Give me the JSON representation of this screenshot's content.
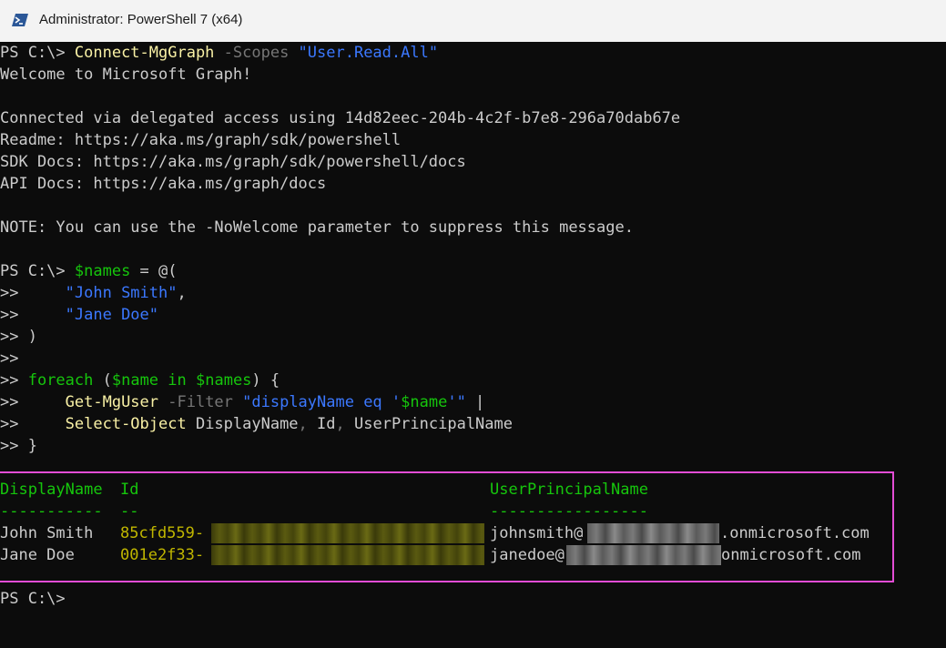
{
  "window": {
    "title": "Administrator: PowerShell 7 (x64)"
  },
  "console": {
    "l1": {
      "prompt": "PS C:\\> ",
      "cmd": "Connect-MgGraph",
      "param": " -Scopes",
      "str": " \"User.Read.All\""
    },
    "l2": "Welcome to Microsoft Graph!",
    "l3": "Connected via delegated access using 14d82eec-204b-4c2f-b7e8-296a70dab67e",
    "l4": "Readme: https://aka.ms/graph/sdk/powershell",
    "l5": "SDK Docs: https://aka.ms/graph/sdk/powershell/docs",
    "l6": "API Docs: https://aka.ms/graph/docs",
    "l7": "NOTE: You can use the -NoWelcome parameter to suppress this message.",
    "l8": {
      "prompt": "PS C:\\> ",
      "var": "$names",
      "rest": " = @("
    },
    "l9": {
      "cont": ">>     ",
      "str": "\"John Smith\"",
      "rest": ","
    },
    "l10": {
      "cont": ">>     ",
      "str": "\"Jane Doe\""
    },
    "l11": ">> )",
    "l12": ">>",
    "l13": {
      "cont": ">> ",
      "kw": "foreach",
      "a": " (",
      "v1": "$name",
      "b": " in ",
      "v2": "$names",
      "c": ") {"
    },
    "l14": {
      "cont": ">>     ",
      "cmd": "Get-MgUser",
      "param": " -Filter",
      "str1": " \"displayName eq '",
      "var": "$name",
      "str2": "'\"",
      "rest": " |"
    },
    "l15": {
      "cont": ">>     ",
      "cmd": "Select-Object",
      "rest": " DisplayName",
      "c1": ", ",
      "r2": "Id",
      "c2": ", ",
      "r3": "UserPrincipalName"
    },
    "l16": ">> }",
    "final_prompt": "PS C:\\>"
  },
  "table": {
    "headers": {
      "displayname": "DisplayName",
      "id": "Id",
      "upn": "UserPrincipalName"
    },
    "underline": {
      "displayname": "-----------",
      "id": "--",
      "upn": "-----------------"
    },
    "rows": [
      {
        "name": "John Smith",
        "id_prefix": "85cfd559-",
        "upn_prefix": "johnsmith@",
        "upn_suffix": ".onmicrosoft.com"
      },
      {
        "name": "Jane Doe",
        "id_prefix": "001e2f33-",
        "upn_prefix": "janedoe@",
        "upn_suffix": "onmicrosoft.com"
      }
    ]
  },
  "colors": {
    "background": "#0c0c0c",
    "text": "#cccccc",
    "command": "#f9f1a5",
    "string": "#3b78ff",
    "variable": "#16c60c",
    "highlight_border": "#e34dd6"
  },
  "icons": {
    "app": "powershell-icon"
  }
}
